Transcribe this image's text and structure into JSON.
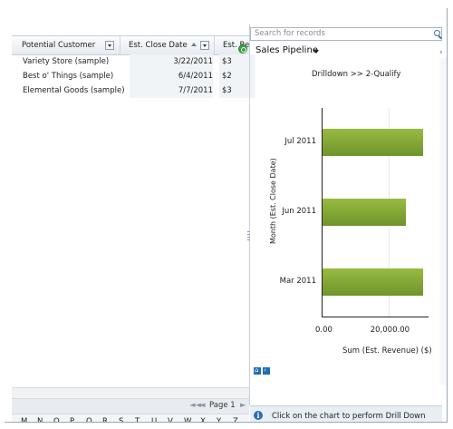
{
  "grid": {
    "columns": [
      "Potential Customer",
      "Est. Close Date",
      "Est. Re"
    ],
    "rows": [
      {
        "customer": "Variety Store (sample)",
        "close_date": "3/22/2011",
        "revenue": "$3"
      },
      {
        "customer": "Best o' Things (sample)",
        "close_date": "6/4/2011",
        "revenue": "$2"
      },
      {
        "customer": "Elemental Goods (sample)",
        "close_date": "7/7/2011",
        "revenue": "$3"
      }
    ],
    "pager": {
      "first": "◄◄",
      "prev": "◄",
      "label": "Page 1",
      "next": "►"
    },
    "alphabet": [
      "M",
      "N",
      "O",
      "P",
      "Q",
      "R",
      "S",
      "T",
      "U",
      "V",
      "W",
      "X",
      "Y",
      "Z"
    ]
  },
  "search": {
    "placeholder": "Search for records"
  },
  "chart_panel": {
    "title": "Sales Pipeline",
    "drilldown_label": "Drilldown >> 2-Qualify",
    "info_text": "Click on the chart to perform Drill Down",
    "info_icon": "i"
  },
  "chart_data": {
    "type": "bar",
    "orientation": "horizontal",
    "title": "Drilldown >> 2-Qualify",
    "categories": [
      "Jul 2011",
      "Jun 2011",
      "Mar 2011"
    ],
    "values": [
      30000,
      25000,
      30000
    ],
    "xlabel": "Sum (Est. Revenue) ($)",
    "ylabel": "Month (Est. Close Date)",
    "xticks": [
      "0.00",
      "20,000.00"
    ],
    "xlim": [
      0,
      32000
    ],
    "grid": false,
    "legend": "none",
    "bar_color": "#7fa435"
  },
  "colors": {
    "accent": "#1f6fb2",
    "bar": "#7fa435"
  }
}
